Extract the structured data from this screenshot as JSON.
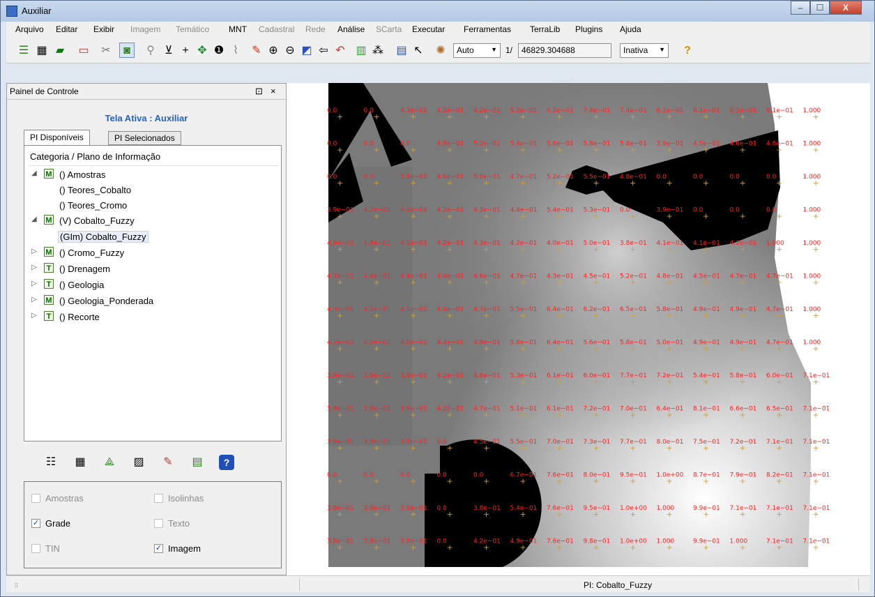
{
  "window": {
    "title": "Auxiliar",
    "controls": {
      "minimize": "–",
      "maximize": "☐",
      "close": "X"
    }
  },
  "menu": [
    {
      "label": "Arquivo",
      "enabled": true
    },
    {
      "label": "Editar",
      "enabled": true
    },
    {
      "label": "Exibir",
      "enabled": true
    },
    {
      "label": "Imagem",
      "enabled": false
    },
    {
      "label": "Temático",
      "enabled": false
    },
    {
      "label": "MNT",
      "enabled": true
    },
    {
      "label": "Cadastral",
      "enabled": false
    },
    {
      "label": "Rede",
      "enabled": false
    },
    {
      "label": "Análise",
      "enabled": true
    },
    {
      "label": "SCarta",
      "enabled": false
    },
    {
      "label": "Executar",
      "enabled": true
    },
    {
      "label": "Ferramentas",
      "enabled": true
    },
    {
      "label": "TerraLib",
      "enabled": true
    },
    {
      "label": "Plugins",
      "enabled": true
    },
    {
      "label": "Ajuda",
      "enabled": true
    }
  ],
  "toolbar": {
    "scale_select": "Auto",
    "scale_prefix": "1/",
    "scale_value": "46829.304688",
    "mode_select": "Inativa",
    "icons": [
      "layers-icon",
      "grid-icon",
      "polygon-icon",
      "frame-icon",
      "cut-icon",
      "selection-icon",
      "zoom-icon",
      "cursor-icon",
      "crosshair-icon",
      "pan-icon",
      "info-icon",
      "clip-icon",
      "edit-icon",
      "zoom-in-icon",
      "zoom-out-icon",
      "zoom-area-icon",
      "back-icon",
      "undo-icon",
      "display-icon",
      "dots-icon",
      "table-icon",
      "pointer-icon",
      "palette-icon"
    ],
    "help_icon": "help-icon"
  },
  "panel": {
    "title": "Painel de Controle",
    "float_glyph": "⊡",
    "close_glyph": "×",
    "active_screen": "Tela Ativa : Auxiliar",
    "tabs": [
      {
        "label": "PI Disponíveis",
        "active": true
      },
      {
        "label": "PI Selecionados",
        "active": false
      }
    ],
    "tree_header": "Categoria / Plano de Informação",
    "tree": [
      {
        "level": 0,
        "toggle": "◢",
        "badge": "M",
        "label": "() Amostras"
      },
      {
        "level": 1,
        "toggle": "",
        "badge": "",
        "label": "() Teores_Cobalto"
      },
      {
        "level": 1,
        "toggle": "",
        "badge": "",
        "label": "() Teores_Cromo"
      },
      {
        "level": 0,
        "toggle": "◢",
        "badge": "M",
        "label": "(V) Cobalto_Fuzzy"
      },
      {
        "level": 1,
        "toggle": "",
        "badge": "",
        "label": "(GIm) Cobalto_Fuzzy",
        "selected": true
      },
      {
        "level": 0,
        "toggle": "▷",
        "badge": "M",
        "label": "() Cromo_Fuzzy"
      },
      {
        "level": 0,
        "toggle": "▷",
        "badge": "T",
        "label": "() Drenagem"
      },
      {
        "level": 0,
        "toggle": "▷",
        "badge": "T",
        "label": "() Geologia"
      },
      {
        "level": 0,
        "toggle": "▷",
        "badge": "M",
        "label": "() Geologia_Ponderada"
      },
      {
        "level": 0,
        "toggle": "▷",
        "badge": "T",
        "label": "() Recorte"
      }
    ],
    "strip_icons": [
      "list-icon",
      "table-view-icon",
      "vector-icon",
      "edit-table-icon",
      "pencil-icon",
      "legend-icon",
      "help-icon"
    ],
    "options": [
      {
        "label": "Amostras",
        "checked": false,
        "enabled": false
      },
      {
        "label": "Isolinhas",
        "checked": false,
        "enabled": false
      },
      {
        "label": "Grade",
        "checked": true,
        "enabled": true
      },
      {
        "label": "Texto",
        "checked": false,
        "enabled": false
      },
      {
        "label": "TIN",
        "checked": false,
        "enabled": false
      },
      {
        "label": "Imagem",
        "checked": true,
        "enabled": true
      }
    ],
    "check_glyph": "✓"
  },
  "status": {
    "grip": "⁞⁞",
    "text": "PI: Cobalto_Fuzzy"
  },
  "grid_labels": [
    [
      "0.0",
      "0.0",
      "4.3e−01",
      "4.2e−01",
      "4.2e−01",
      "5.2e−01",
      "6.2e−01",
      "7.4e−01",
      "7.4e−01",
      "6.1e−01",
      "6.1e−01",
      "6.1e−01",
      "6.1e−01",
      "1.000"
    ],
    [
      "0.0",
      "0.0",
      "0.0",
      "4.8e−01",
      "5.2e−01",
      "5.4e−01",
      "5.6e−01",
      "5.8e−01",
      "5.8e−01",
      "3.9e−01",
      "4.5e−01",
      "4.6e−01",
      "4.6e−01",
      "1.000"
    ],
    [
      "0.0",
      "0.0",
      "3.8e−01",
      "4.6e−01",
      "5.0e−01",
      "4.7e−01",
      "5.2e−01",
      "5.5e−01",
      "4.8e−01",
      "0.0",
      "0.0",
      "0.0",
      "0.0",
      "1.000"
    ],
    [
      "3.9e−01",
      "4.2e−01",
      "4.0e−01",
      "4.2e−01",
      "4.3e−01",
      "4.4e−01",
      "5.4e−01",
      "5.3e−01",
      "0.0",
      "3.9e−01",
      "0.0",
      "0.0",
      "0.0",
      "1.000"
    ],
    [
      "4.9e−01",
      "4.9e−01",
      "4.1e−01",
      "4.2e−01",
      "4.3e−01",
      "4.2e−01",
      "4.0e−01",
      "5.0e−01",
      "3.8e−01",
      "4.1e−01",
      "4.1e−01",
      "4.2e−01",
      "1.000",
      "1.000"
    ],
    [
      "4.7e−01",
      "4.4e−01",
      "4.4e−01",
      "4.4e−01",
      "4.6e−01",
      "4.7e−01",
      "4.3e−01",
      "4.5e−01",
      "5.2e−01",
      "4.8e−01",
      "4.5e−01",
      "4.7e−01",
      "4.7e−01",
      "1.000"
    ],
    [
      "4.3e−01",
      "4.2e−01",
      "4.1e−01",
      "4.4e−01",
      "4.7e−01",
      "5.5e−01",
      "6.4e−01",
      "6.2e−01",
      "6.5e−01",
      "5.8e−01",
      "4.9e−01",
      "4.9e−01",
      "4.7e−01",
      "1.000"
    ],
    [
      "4.2e−01",
      "4.0e−01",
      "4.0e−01",
      "4.2e−01",
      "4.9e−01",
      "5.8e−01",
      "6.4e−01",
      "5.6e−01",
      "5.8e−01",
      "5.0e−01",
      "4.9e−01",
      "4.9e−01",
      "4.7e−01",
      "1.000"
    ],
    [
      "3.9e−01",
      "3.9e−01",
      "3.9e−01",
      "4.2e−01",
      "4.6e−01",
      "5.3e−01",
      "6.1e−01",
      "6.0e−01",
      "7.7e−01",
      "7.2e−01",
      "5.4e−01",
      "5.8e−01",
      "6.0e−01",
      "7.1e−01"
    ],
    [
      "3.9e−01",
      "3.9e−01",
      "3.9e−01",
      "4.2e−01",
      "4.7e−01",
      "5.1e−01",
      "6.1e−01",
      "7.2e−01",
      "7.0e−01",
      "6.4e−01",
      "8.1e−01",
      "6.6e−01",
      "6.5e−01",
      "7.1e−01"
    ],
    [
      "3.9e−01",
      "3.9e−01",
      "3.9e−01",
      "0.0",
      "4.5e−01",
      "5.5e−01",
      "7.0e−01",
      "7.3e−01",
      "7.7e−01",
      "8.0e−01",
      "7.5e−01",
      "7.2e−01",
      "7.1e−01",
      "7.1e−01"
    ],
    [
      "0.0",
      "0.0",
      "0.0",
      "0.0",
      "0.0",
      "6.7e−01",
      "7.6e−01",
      "8.0e−01",
      "9.5e−01",
      "1.0e+00",
      "8.7e−01",
      "7.9e−01",
      "8.2e−01",
      "7.1e−01"
    ],
    [
      "3.8e−01",
      "3.8e−01",
      "3.8e−01",
      "0.0",
      "3.8e−01",
      "5.4e−01",
      "7.6e−01",
      "9.5e−01",
      "1.0e+00",
      "1.000",
      "9.9e−01",
      "7.1e−01",
      "7.1e−01",
      "7.1e−01"
    ],
    [
      "3.8e−01",
      "3.8e−01",
      "3.8e−01",
      "0.0",
      "4.2e−01",
      "4.9e−01",
      "7.6e−01",
      "9.8e−01",
      "1.0e+00",
      "1.000",
      "9.9e−01",
      "1.000",
      "7.1e−01",
      "7.1e−01"
    ]
  ]
}
